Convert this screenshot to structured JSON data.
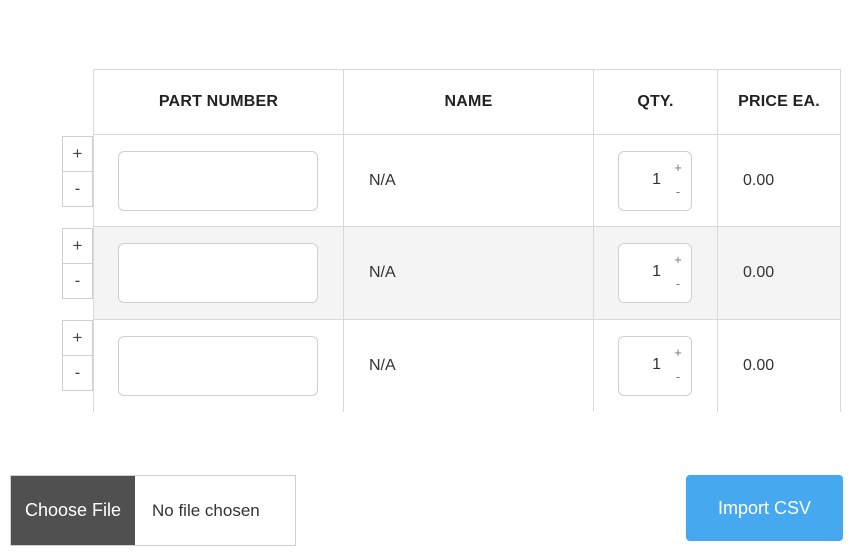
{
  "table": {
    "headers": {
      "part_number": "PART NUMBER",
      "name": "NAME",
      "qty": "QTY.",
      "price": "PRICE EA."
    },
    "rows": [
      {
        "part_number": "",
        "name": "N/A",
        "qty": "1",
        "price": "0.00"
      },
      {
        "part_number": "",
        "name": "N/A",
        "qty": "1",
        "price": "0.00"
      },
      {
        "part_number": "",
        "name": "N/A",
        "qty": "1",
        "price": "0.00"
      }
    ]
  },
  "row_controls": {
    "add": "+",
    "remove": "-"
  },
  "qty_stepper": {
    "up": "+",
    "down": "-"
  },
  "file_picker": {
    "button_label": "Choose File",
    "status": "No file chosen"
  },
  "import_button": {
    "label": "Import CSV"
  },
  "colors": {
    "import_button_bg": "#46a9f0",
    "choose_file_bg": "#505050",
    "alt_row_bg": "#f4f4f4",
    "border": "#d9d9d9"
  }
}
